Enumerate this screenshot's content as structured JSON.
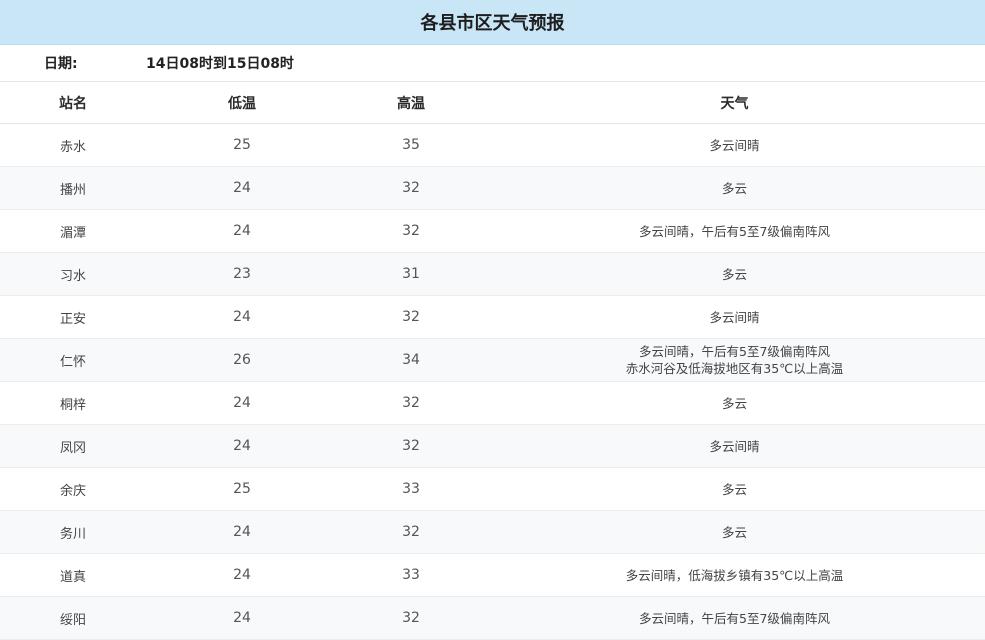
{
  "title": "各县市区天气预报",
  "date": {
    "label": "日期:",
    "value": "14日08时到15日08时"
  },
  "columns": {
    "station": "站名",
    "low": "低温",
    "high": "高温",
    "weather": "天气"
  },
  "rows": [
    {
      "station": "赤水",
      "low": "25",
      "high": "35",
      "weather": [
        "多云间晴"
      ]
    },
    {
      "station": "播州",
      "low": "24",
      "high": "32",
      "weather": [
        "多云"
      ]
    },
    {
      "station": "湄潭",
      "low": "24",
      "high": "32",
      "weather": [
        "多云间晴，午后有5至7级偏南阵风"
      ]
    },
    {
      "station": "习水",
      "low": "23",
      "high": "31",
      "weather": [
        "多云"
      ]
    },
    {
      "station": "正安",
      "low": "24",
      "high": "32",
      "weather": [
        "多云间晴"
      ]
    },
    {
      "station": "仁怀",
      "low": "26",
      "high": "34",
      "weather": [
        "多云间晴，午后有5至7级偏南阵风",
        "赤水河谷及低海拔地区有35℃以上高温"
      ]
    },
    {
      "station": "桐梓",
      "low": "24",
      "high": "32",
      "weather": [
        "多云"
      ]
    },
    {
      "station": "凤冈",
      "low": "24",
      "high": "32",
      "weather": [
        "多云间晴"
      ]
    },
    {
      "station": "余庆",
      "low": "25",
      "high": "33",
      "weather": [
        "多云"
      ]
    },
    {
      "station": "务川",
      "low": "24",
      "high": "32",
      "weather": [
        "多云"
      ]
    },
    {
      "station": "道真",
      "low": "24",
      "high": "33",
      "weather": [
        "多云间晴，低海拔乡镇有35℃以上高温"
      ]
    },
    {
      "station": "绥阳",
      "low": "24",
      "high": "32",
      "weather": [
        "多云间晴，午后有5至7级偏南阵风"
      ]
    }
  ]
}
